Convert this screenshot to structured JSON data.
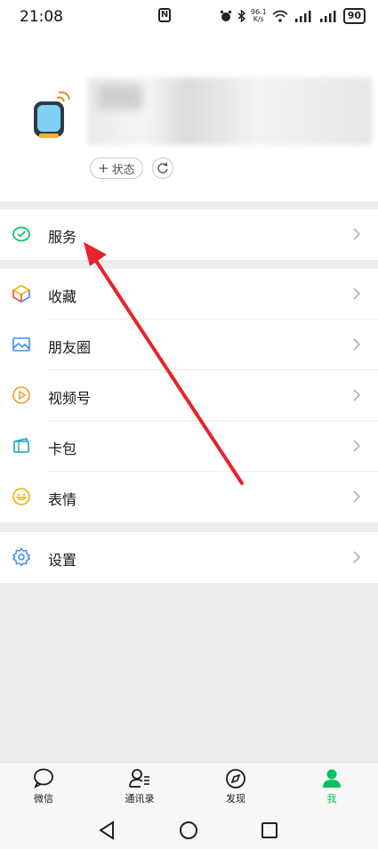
{
  "status_bar": {
    "time": "21:08",
    "nfc": "N",
    "network_speed_value": "96.1",
    "network_speed_unit": "K/s",
    "battery": "90"
  },
  "profile": {
    "status_button_label": "状态",
    "status_button_prefix": "+"
  },
  "menu": {
    "service": "服务",
    "favorites": "收藏",
    "moments": "朋友圈",
    "channels": "视频号",
    "cards": "卡包",
    "stickers": "表情",
    "settings": "设置"
  },
  "tabbar": {
    "chats": "微信",
    "contacts": "通讯录",
    "discover": "发现",
    "me": "我"
  },
  "colors": {
    "accent": "#07c160",
    "annotation_arrow": "#e5242b"
  }
}
